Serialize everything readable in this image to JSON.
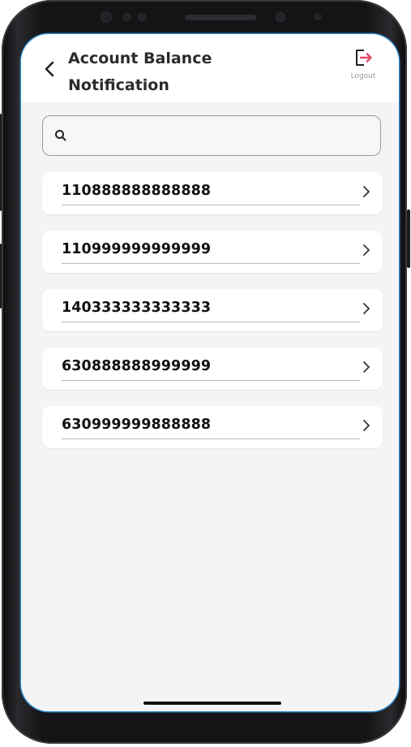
{
  "header": {
    "title_line1": "Account Balance",
    "title_line2": "Notification",
    "logout_label": "Logout"
  },
  "search": {
    "value": "",
    "placeholder": ""
  },
  "accounts": [
    "110888888888888",
    "110999999999999",
    "140333333333333",
    "630888888999999",
    "630999999888888"
  ],
  "colors": {
    "screen_bg": "#f4f4f6",
    "card_bg": "#ffffff",
    "logout_accent": "#e24a6a",
    "screen_border": "#2e86c9"
  },
  "icons": {
    "back": "back-arrow-icon",
    "logout": "logout-icon",
    "search": "search-icon",
    "chevron": "chevron-right-icon"
  }
}
